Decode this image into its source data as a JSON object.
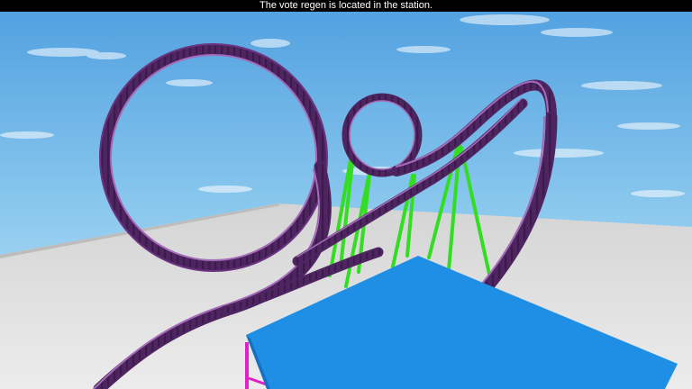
{
  "message": {
    "text": "The vote regen is located in the station."
  },
  "colors": {
    "sky_top": "#4f9fe0",
    "sky_horizon": "#bfe4f7",
    "ground": "#e6e6e6",
    "ground_far": "#cfcfcf",
    "track": "#7a3f8f",
    "track_dark": "#4e2560",
    "track_light": "#a46bb8",
    "supports": "#33dd22",
    "platform_top": "#1f8fe6",
    "platform_side": "#1670bf",
    "platform_legs": "#e020c8",
    "message_bar": "#000000",
    "message_text": "#ffffff"
  }
}
